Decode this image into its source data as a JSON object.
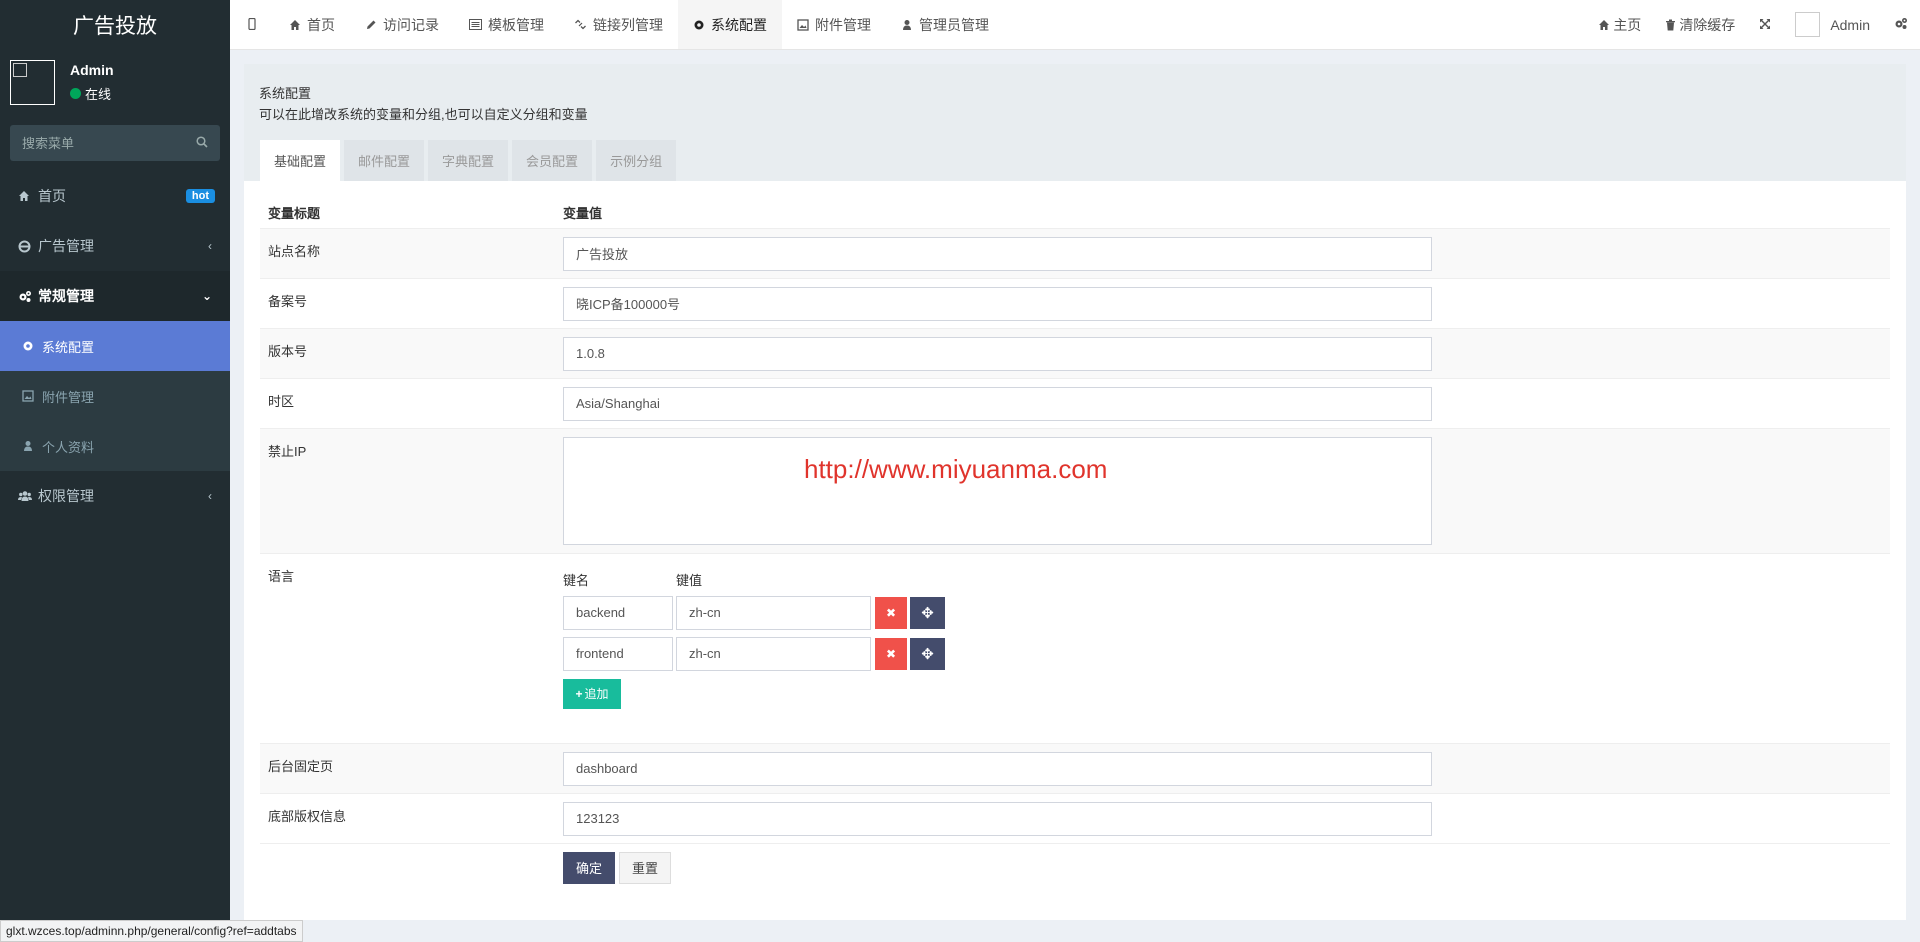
{
  "app": {
    "title": "广告投放"
  },
  "user": {
    "name": "Admin",
    "status": "在线"
  },
  "search": {
    "placeholder": "搜索菜单"
  },
  "sidebar": {
    "home": {
      "label": "首页",
      "badge": "hot"
    },
    "ads": {
      "label": "广告管理"
    },
    "general": {
      "label": "常规管理"
    },
    "sub": [
      {
        "label": "系统配置"
      },
      {
        "label": "附件管理"
      },
      {
        "label": "个人资料"
      }
    ],
    "auth": {
      "label": "权限管理"
    }
  },
  "topbar": {
    "tabs": [
      {
        "label": "首页"
      },
      {
        "label": "访问记录"
      },
      {
        "label": "模板管理"
      },
      {
        "label": "链接列管理"
      },
      {
        "label": "系统配置"
      },
      {
        "label": "附件管理"
      },
      {
        "label": "管理员管理"
      }
    ],
    "right": {
      "home": "主页",
      "clear_cache": "清除缓存",
      "user": "Admin"
    }
  },
  "content": {
    "title": "系统配置",
    "desc": "可以在此增改系统的变量和分组,也可以自定义分组和变量",
    "tabs": [
      "基础配置",
      "邮件配置",
      "字典配置",
      "会员配置",
      "示例分组"
    ],
    "col_title": "变量标题",
    "col_value": "变量值",
    "fields": {
      "site_name": {
        "label": "站点名称",
        "value": "广告投放"
      },
      "beian": {
        "label": "备案号",
        "value": "晓ICP备100000号"
      },
      "version": {
        "label": "版本号",
        "value": "1.0.8"
      },
      "timezone": {
        "label": "时区",
        "value": "Asia/Shanghai"
      },
      "forbid_ip": {
        "label": "禁止IP",
        "watermark": "http://www.miyuanma.com"
      },
      "language": {
        "label": "语言",
        "key_header": "键名",
        "value_header": "键值",
        "rows": [
          {
            "key": "backend",
            "value": "zh-cn"
          },
          {
            "key": "frontend",
            "value": "zh-cn"
          }
        ],
        "add_label": "追加"
      },
      "fixedpage": {
        "label": "后台固定页",
        "value": "dashboard"
      },
      "copyright": {
        "label": "底部版权信息",
        "value": "123123"
      }
    },
    "submit_label": "确定",
    "reset_label": "重置"
  },
  "statusbar": {
    "url": "glxt.wzces.top/adminn.php/general/config?ref=addtabs"
  }
}
